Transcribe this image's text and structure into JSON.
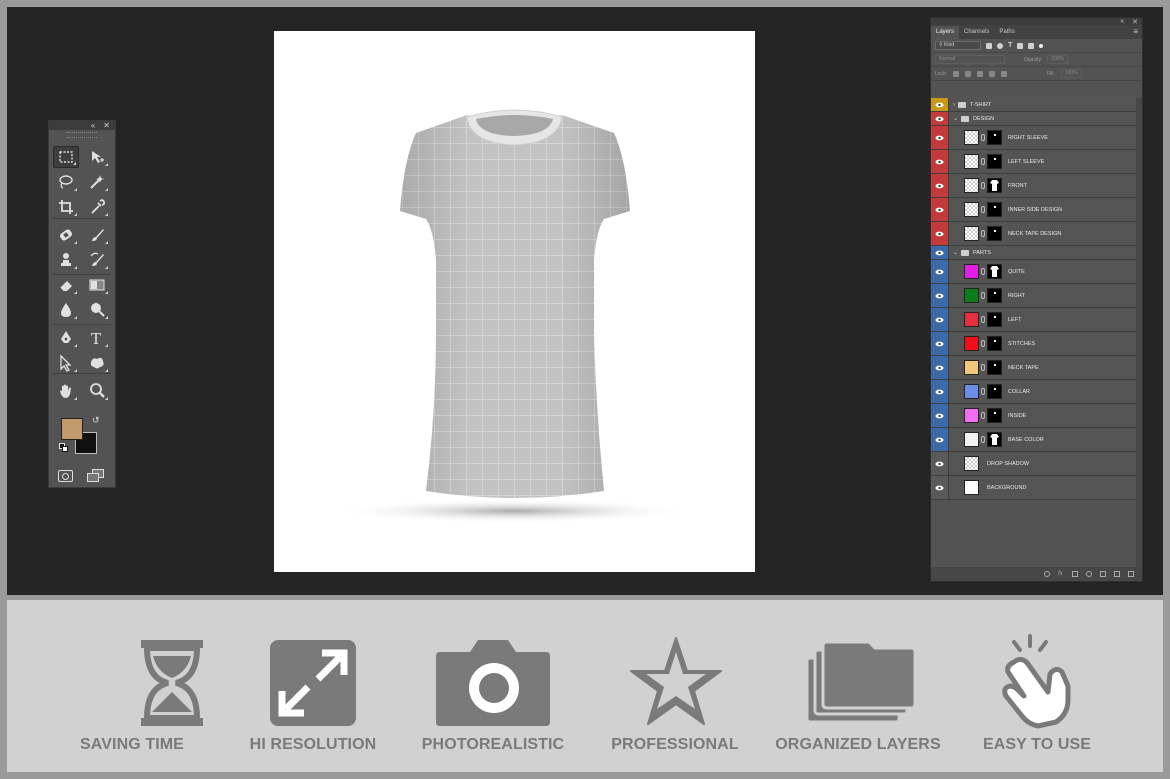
{
  "layers_panel": {
    "tabs": [
      "Layers",
      "Channels",
      "Paths"
    ],
    "filter_kind": "Kind",
    "blend_mode": "Normal",
    "opacity_label": "Opacity:",
    "opacity_value": "100%",
    "lock_label": "Lock:",
    "fill_label": "Fill:",
    "fill_value": "100%",
    "layers": [
      {
        "name": "T-SHIRT",
        "type": "group",
        "collapsed": true,
        "eye_color": "#c49a17"
      },
      {
        "name": "DESIGN",
        "type": "group",
        "collapsed": false,
        "eye_color": "#c33a3a"
      },
      {
        "name": "RIGHT SLEEVE",
        "type": "smart",
        "eye_color": "#c33a3a"
      },
      {
        "name": "LEFT SLEEVE",
        "type": "smart",
        "eye_color": "#c33a3a"
      },
      {
        "name": "FRONT",
        "type": "smart",
        "eye_color": "#c33a3a"
      },
      {
        "name": "INNER SIDE DESIGN",
        "type": "smart",
        "eye_color": "#c33a3a"
      },
      {
        "name": "NECK TAPE DESIGN",
        "type": "smart",
        "eye_color": "#c33a3a"
      },
      {
        "name": "PARTS",
        "type": "group",
        "collapsed": false,
        "eye_color": "#3a6aa8"
      },
      {
        "name": "QUITE",
        "type": "color",
        "swatch": "#e11ee1",
        "eye_color": "#3a6aa8"
      },
      {
        "name": "RIGHT",
        "type": "color",
        "swatch": "#0c7d1a",
        "eye_color": "#3a6aa8"
      },
      {
        "name": "LEFT",
        "type": "color",
        "swatch": "#e23040",
        "eye_color": "#3a6aa8"
      },
      {
        "name": "STITCHES",
        "type": "color",
        "swatch": "#f00f18",
        "eye_color": "#3a6aa8"
      },
      {
        "name": "NECK TAPE",
        "type": "color",
        "swatch": "#f0c87a",
        "eye_color": "#3a6aa8"
      },
      {
        "name": "COLLAR",
        "type": "color",
        "swatch": "#6e8ee6",
        "eye_color": "#3a6aa8"
      },
      {
        "name": "INSIDE",
        "type": "color",
        "swatch": "#f06ef0",
        "eye_color": "#3a6aa8"
      },
      {
        "name": "BASE COLOR",
        "type": "color",
        "swatch": "#f2f2f2",
        "eye_color": "#3a6aa8"
      },
      {
        "name": "DROP SHADOW",
        "type": "plain",
        "eye_color": "#5a5a5a"
      },
      {
        "name": "BACKGROUND",
        "type": "plain",
        "eye_color": "#5a5a5a"
      }
    ]
  },
  "toolbox": {
    "foreground_color": "#c49a6c",
    "background_color": "#111111",
    "tools": [
      "marquee-icon",
      "move-icon",
      "lasso-icon",
      "magic-wand-icon",
      "crop-icon",
      "eyedropper-icon",
      "healing-icon",
      "brush-icon",
      "stamp-icon",
      "history-brush-icon",
      "eraser-icon",
      "gradient-icon",
      "blur-icon",
      "dodge-icon",
      "pen-icon",
      "type-icon",
      "path-select-icon",
      "shape-icon",
      "hand-icon",
      "zoom-icon"
    ]
  },
  "features": [
    {
      "label": "SAVING TIME",
      "icon": "hourglass-icon"
    },
    {
      "label": "HI RESOLUTION",
      "icon": "expand-icon"
    },
    {
      "label": "PHOTOREALISTIC",
      "icon": "camera-icon"
    },
    {
      "label": "PROFESSIONAL",
      "icon": "star-icon"
    },
    {
      "label": "ORGANIZED LAYERS",
      "icon": "layers-folder-icon"
    },
    {
      "label": "EASY TO USE",
      "icon": "click-hand-icon"
    }
  ],
  "colors": {
    "workspace": "#242424",
    "panel": "#535353",
    "feature_gray": "#7a7a7a"
  }
}
